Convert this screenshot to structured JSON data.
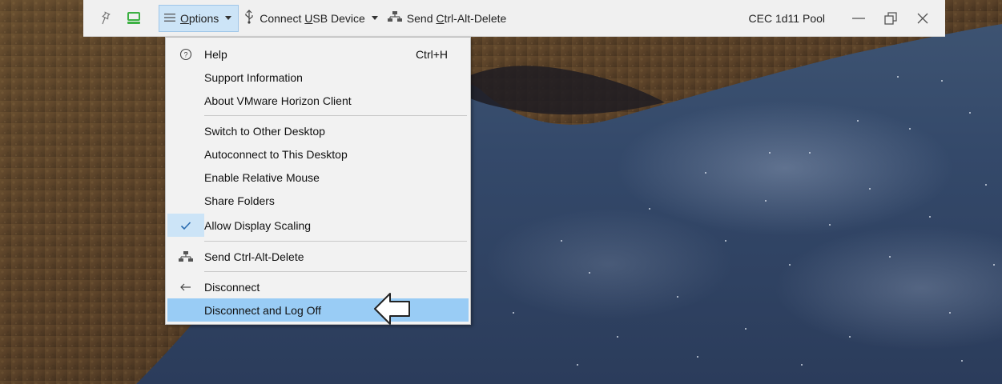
{
  "toolbar": {
    "options_label": "Options",
    "options_mnemonic": "O",
    "options_rest": "ptions",
    "usb_label_pre": "Connect ",
    "usb_mnemonic": "U",
    "usb_label_post": "SB Device",
    "cad_label_pre": "Send ",
    "cad_mnemonic": "C",
    "cad_label_post": "trl-Alt-Delete",
    "pool_name": "CEC 1d11 Pool"
  },
  "menu": {
    "items": [
      {
        "label": "Help",
        "shortcut": "Ctrl+H",
        "icon": "help-circle-icon"
      },
      {
        "label": "Support Information"
      },
      {
        "label": "About VMware Horizon Client"
      },
      {
        "label": "Switch to Other Desktop"
      },
      {
        "label": "Autoconnect to This Desktop"
      },
      {
        "label": "Enable Relative Mouse"
      },
      {
        "label": "Share Folders"
      },
      {
        "label": "Allow Display Scaling",
        "checked": true,
        "icon": "checkmark-icon"
      },
      {
        "label": "Send Ctrl-Alt-Delete",
        "icon": "network-icon"
      },
      {
        "label": "Disconnect",
        "icon": "arrow-left-icon"
      },
      {
        "label": "Disconnect and Log Off",
        "highlighted": true
      }
    ]
  },
  "colors": {
    "toolbar_bg": "#f0f0f0",
    "options_active_bg": "#cce4f7",
    "menu_bg": "#f2f2f2",
    "menu_highlight": "#99ccf5",
    "check_color": "#2b6cb0",
    "monitor_icon_green": "#3cb043"
  }
}
